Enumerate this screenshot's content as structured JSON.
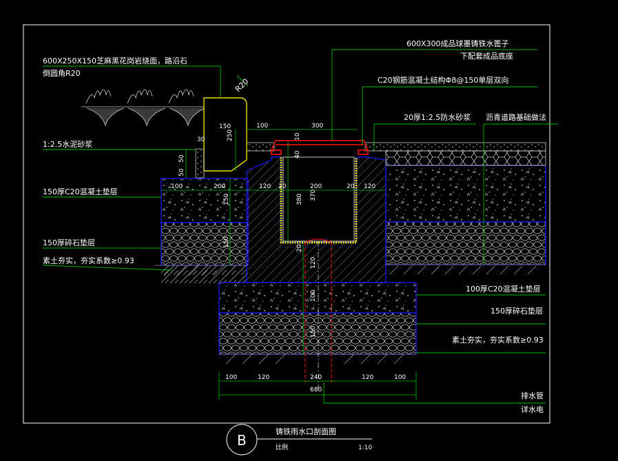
{
  "colors": {
    "background": "#000000",
    "frame": "#ffffff",
    "leader": "#00c000",
    "outline_blue": "#1a1aff",
    "cover_red": "#e01010",
    "text": "#ffffff",
    "dim_line": "#00c000",
    "mortar_yellow": "#e8e000"
  },
  "labels": {
    "curb": "600X250X150芝麻黑花岗岩烧面，路沿石",
    "curb_chamfer": "倒圆角R20",
    "radius": "R20",
    "grate": "600X300成品球墨铸铁水篦子",
    "grate_sub": "下配套成品底座",
    "structure": "C20钢筋混凝土结构Φ8@150单层双向",
    "waterproof": "20厚1:2.5防水砂浆",
    "asphalt": "沥青道路基础做法",
    "mortar": "1:2.5水泥砂浆",
    "concrete150": "150厚C20混凝土垫层",
    "gravel150_left": "150厚碎石垫层",
    "soil_left": "素土夯实，夯实系数≥0.93",
    "concrete100": "100厚C20混凝土垫层",
    "gravel150_right": "150厚碎石垫层",
    "soil_right": "素土夯实，夯实系数≥0.93",
    "pipe": "排水管",
    "pipe_sub": "详水电"
  },
  "dimensions": {
    "top": [
      "100",
      "300"
    ],
    "curb_w": "150",
    "curb_h": "250",
    "left_30": "30",
    "left_50a": "50",
    "left_50b": "50",
    "left_100": "100",
    "left_200": "200",
    "layer_150a": "150",
    "layer_150b": "150",
    "wall_120a": "120",
    "wall_20a": "20",
    "inner_200": "200",
    "wall_20b": "20",
    "wall_120b": "120",
    "v40": "40",
    "v10": "10",
    "v380": "380",
    "v370": "370",
    "v20": "20",
    "v120": "120",
    "v100": "100",
    "v150": "150",
    "bottom": [
      "100",
      "120",
      "240",
      "120",
      "100"
    ],
    "total": "680"
  },
  "title": {
    "letter": "B",
    "name": "铸铁雨水口剖面图",
    "sub_left": "比例",
    "scale": "1:10"
  }
}
